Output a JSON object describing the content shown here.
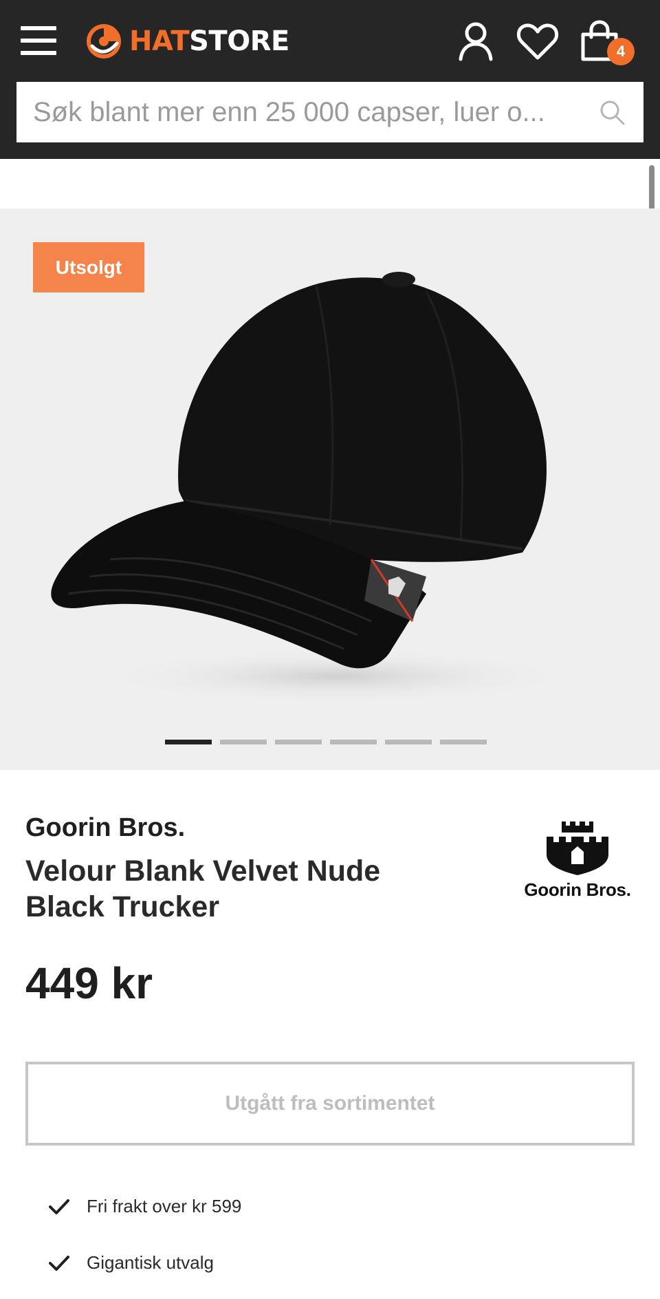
{
  "header": {
    "logo": {
      "part1": "HAT",
      "part2": "STORE"
    },
    "cart_count": "4",
    "icons": [
      "menu-icon",
      "account-icon",
      "heart-icon",
      "shopping-bag-icon"
    ],
    "accent_color": "#f26f2b",
    "background_color": "#262626"
  },
  "search": {
    "placeholder": "Søk blant mer enn 25 000 capser, luer o..."
  },
  "gallery": {
    "badge": "Utsolgt",
    "image_count": 6,
    "active_index": 0
  },
  "product": {
    "brand": "Goorin Bros.",
    "name": "Velour Blank Velvet Nude Black Trucker",
    "price": "449 kr",
    "brand_logo_text": "Goorin Bros.",
    "status_button": "Utgått fra sortimentet"
  },
  "usps": [
    {
      "text": "Fri frakt over kr 599",
      "icon": "checkmark-icon"
    },
    {
      "text": "Gigantisk utvalg",
      "icon": "checkmark-icon"
    }
  ]
}
